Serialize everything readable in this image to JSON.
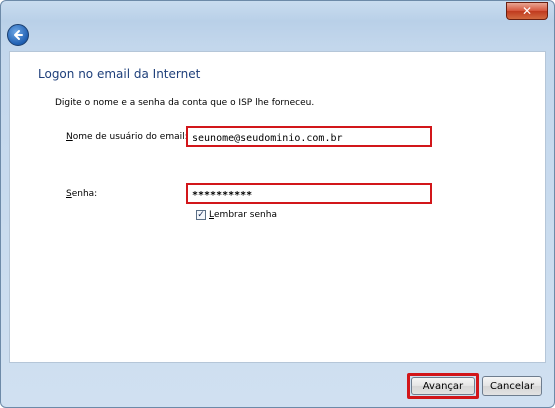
{
  "window": {
    "close_glyph": "✕",
    "back_icon": "back-arrow-icon"
  },
  "dialog": {
    "title": "Logon no email da Internet",
    "instruction": "Digite o nome e a senha da conta que o ISP lhe forneceu.",
    "username": {
      "label_first": "N",
      "label_rest": "ome de usuário do email:",
      "value": "seunome@seudominio.com.br"
    },
    "password": {
      "label_first": "S",
      "label_rest": "enha:",
      "value": "**********"
    },
    "remember": {
      "label_first": "L",
      "label_rest": "embrar senha",
      "checked": true,
      "check_glyph": "✓"
    }
  },
  "buttons": {
    "next_label": "Avançar",
    "cancel_label": "Cancelar"
  },
  "colors": {
    "highlight": "#d2161a",
    "title": "#1e3f7a"
  }
}
